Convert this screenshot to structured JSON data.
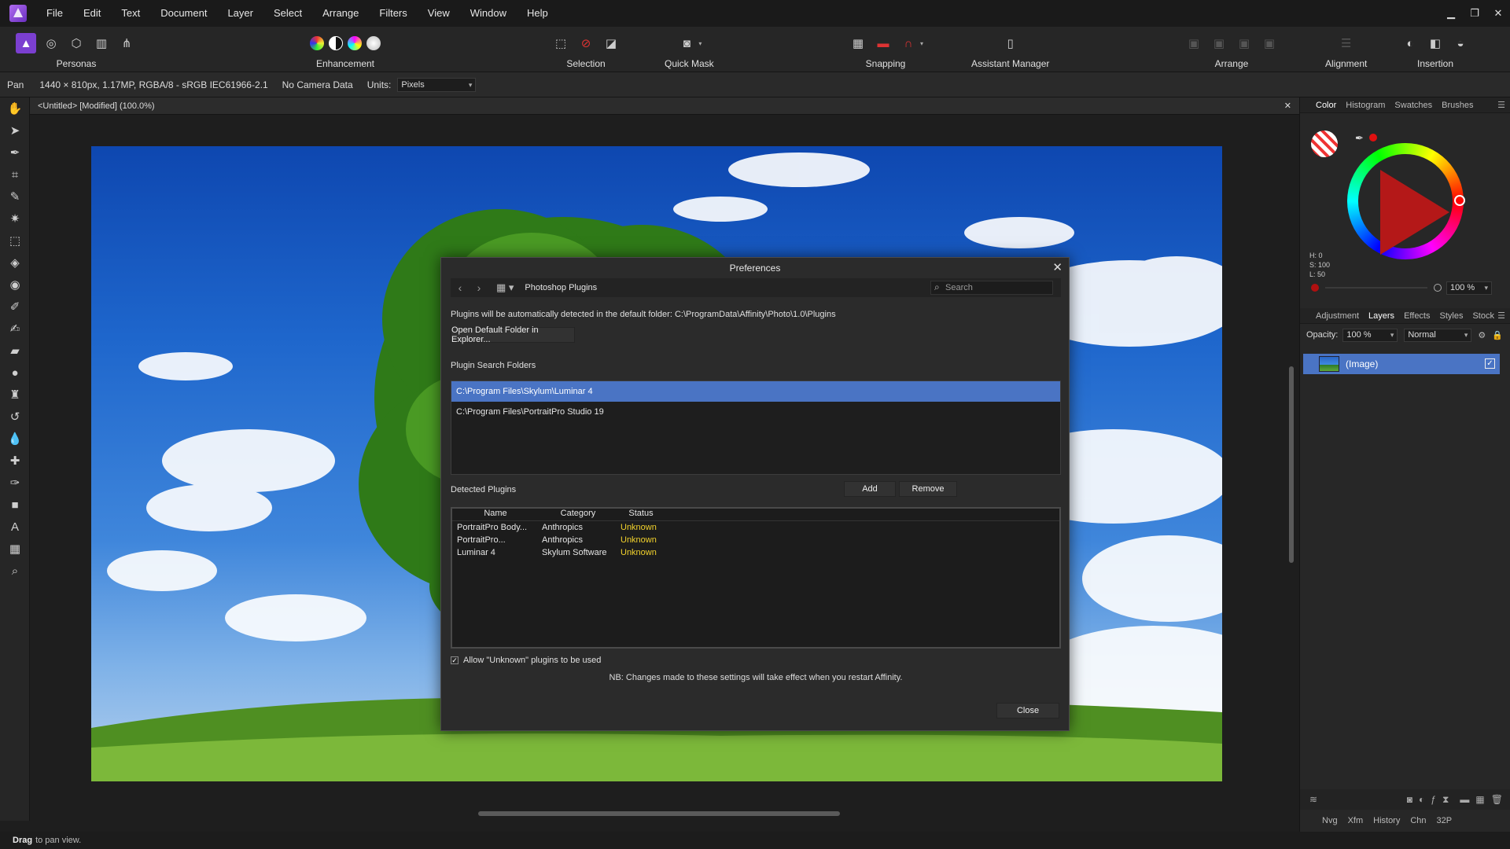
{
  "menubar": {
    "items": [
      "File",
      "Edit",
      "Text",
      "Document",
      "Layer",
      "Select",
      "Arrange",
      "Filters",
      "View",
      "Window",
      "Help"
    ]
  },
  "toolbar": {
    "personas_label": "Personas",
    "enhancement_label": "Enhancement",
    "selection_label": "Selection",
    "quickmask_label": "Quick Mask",
    "snapping_label": "Snapping",
    "assistant_label": "Assistant Manager",
    "arrange_label": "Arrange",
    "alignment_label": "Alignment",
    "insertion_label": "Insertion"
  },
  "context": {
    "tool": "Pan",
    "doc_info": "1440 × 810px, 1.17MP, RGBA/8 - sRGB IEC61966-2.1",
    "camera": "No Camera Data",
    "units_label": "Units:",
    "units_value": "Pixels"
  },
  "document": {
    "tab_title": "<Untitled> [Modified] (100.0%)"
  },
  "status": {
    "bold": "Drag",
    "text": "to pan view."
  },
  "color_panel": {
    "tabs": [
      "Color",
      "Histogram",
      "Swatches",
      "Brushes"
    ],
    "h": "H: 0",
    "s": "S: 100",
    "l": "L: 50",
    "opacity_value": "100 %",
    "current_color": "#e01010"
  },
  "layers_panel": {
    "tabs": [
      "Adjustment",
      "Layers",
      "Effects",
      "Styles",
      "Stock"
    ],
    "opacity_label": "Opacity:",
    "opacity_value": "100 %",
    "blend_mode": "Normal",
    "layer_name": "(Image)"
  },
  "bottom_tabs": [
    "Nvg",
    "Xfm",
    "History",
    "Chn",
    "32P"
  ],
  "dialog": {
    "title": "Preferences",
    "section": "Photoshop Plugins",
    "search_placeholder": "Search",
    "default_folder_text": "Plugins will be automatically detected in the default folder: C:\\ProgramData\\Affinity\\Photo\\1.0\\Plugins",
    "open_folder_button": "Open Default Folder in Explorer...",
    "search_folders_label": "Plugin Search Folders",
    "folders": [
      "C:\\Program Files\\Skylum\\Luminar 4",
      "C:\\Program Files\\PortraitPro Studio 19"
    ],
    "detected_label": "Detected Plugins",
    "add_button": "Add",
    "remove_button": "Remove",
    "columns": [
      "Name",
      "Category",
      "Status"
    ],
    "plugins": [
      {
        "name": "PortraitPro Body...",
        "category": "Anthropics",
        "status": "Unknown"
      },
      {
        "name": "PortraitPro...",
        "category": "Anthropics",
        "status": "Unknown"
      },
      {
        "name": "Luminar 4",
        "category": "Skylum Software",
        "status": "Unknown"
      }
    ],
    "allow_unknown_label": "Allow \"Unknown\" plugins to be used",
    "note": "NB: Changes made to these settings will take effect when you restart Affinity.",
    "close_button": "Close"
  }
}
